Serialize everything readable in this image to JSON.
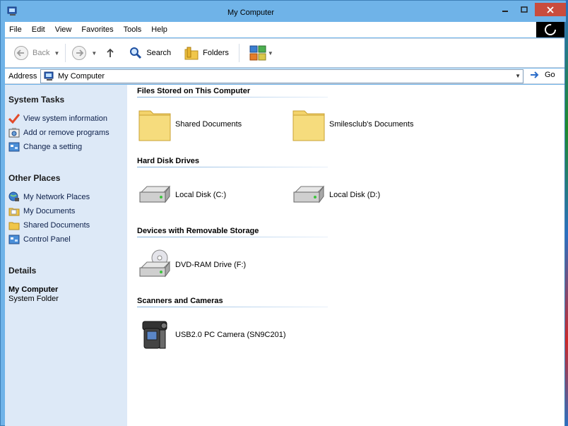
{
  "window": {
    "title": "My Computer"
  },
  "menu": {
    "items": [
      "File",
      "Edit",
      "View",
      "Favorites",
      "Tools",
      "Help"
    ]
  },
  "toolbar": {
    "back_label": "Back",
    "search_label": "Search",
    "folders_label": "Folders"
  },
  "address": {
    "label": "Address",
    "value": "My Computer",
    "go_label": "Go"
  },
  "left_panel": {
    "system_tasks": {
      "heading": "System Tasks",
      "items": [
        "View system information",
        "Add or remove programs",
        "Change a setting"
      ]
    },
    "other_places": {
      "heading": "Other Places",
      "items": [
        "My Network Places",
        "My Documents",
        "Shared Documents",
        "Control Panel"
      ]
    },
    "details": {
      "heading": "Details",
      "name": "My Computer",
      "type": "System Folder"
    }
  },
  "groups": {
    "files": {
      "heading": "Files Stored on This Computer",
      "items": [
        "Shared Documents",
        "Smilesclub's Documents"
      ]
    },
    "drives": {
      "heading": "Hard Disk Drives",
      "items": [
        "Local Disk (C:)",
        "Local Disk (D:)"
      ]
    },
    "removable": {
      "heading": "Devices with Removable Storage",
      "items": [
        "DVD-RAM Drive (F:)"
      ]
    },
    "scanners": {
      "heading": "Scanners and Cameras",
      "items": [
        "USB2.0 PC Camera (SN9C201)"
      ]
    }
  },
  "colors": {
    "titlebar": "#6fb3e8",
    "close_button": "#c94c3d",
    "left_panel": "#dde9f7",
    "link_text": "#0c1f4a"
  }
}
